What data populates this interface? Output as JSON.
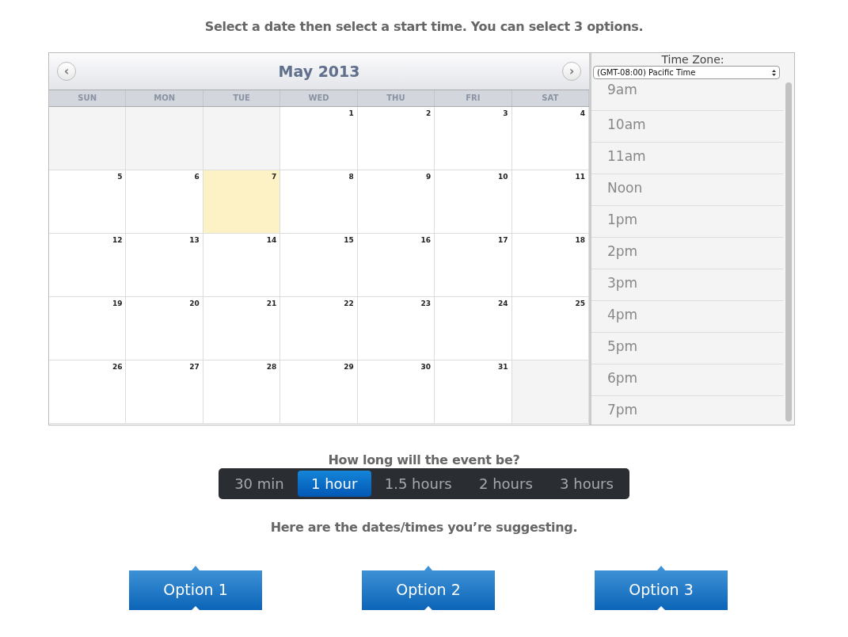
{
  "instructions": "Select a date then select a start time. You can select 3 options.",
  "calendar": {
    "title": "May 2013",
    "prev": "‹",
    "next": "›",
    "weekdays": [
      "SUN",
      "MON",
      "TUE",
      "WED",
      "THU",
      "FRI",
      "SAT"
    ],
    "weeks": [
      [
        {
          "kind": "blank"
        },
        {
          "kind": "blank"
        },
        {
          "kind": "blank"
        },
        {
          "kind": "day",
          "label": "1",
          "today": false
        },
        {
          "kind": "day",
          "label": "2",
          "today": false
        },
        {
          "kind": "day",
          "label": "3",
          "today": false
        },
        {
          "kind": "day",
          "label": "4",
          "today": false
        }
      ],
      [
        {
          "kind": "day",
          "label": "5",
          "today": false
        },
        {
          "kind": "day",
          "label": "6",
          "today": false
        },
        {
          "kind": "day",
          "label": "7",
          "today": true
        },
        {
          "kind": "day",
          "label": "8",
          "today": false
        },
        {
          "kind": "day",
          "label": "9",
          "today": false
        },
        {
          "kind": "day",
          "label": "10",
          "today": false
        },
        {
          "kind": "day",
          "label": "11",
          "today": false
        }
      ],
      [
        {
          "kind": "day",
          "label": "12",
          "today": false
        },
        {
          "kind": "day",
          "label": "13",
          "today": false
        },
        {
          "kind": "day",
          "label": "14",
          "today": false
        },
        {
          "kind": "day",
          "label": "15",
          "today": false
        },
        {
          "kind": "day",
          "label": "16",
          "today": false
        },
        {
          "kind": "day",
          "label": "17",
          "today": false
        },
        {
          "kind": "day",
          "label": "18",
          "today": false
        }
      ],
      [
        {
          "kind": "day",
          "label": "19",
          "today": false
        },
        {
          "kind": "day",
          "label": "20",
          "today": false
        },
        {
          "kind": "day",
          "label": "21",
          "today": false
        },
        {
          "kind": "day",
          "label": "22",
          "today": false
        },
        {
          "kind": "day",
          "label": "23",
          "today": false
        },
        {
          "kind": "day",
          "label": "24",
          "today": false
        },
        {
          "kind": "day",
          "label": "25",
          "today": false
        }
      ],
      [
        {
          "kind": "day",
          "label": "26",
          "today": false
        },
        {
          "kind": "day",
          "label": "27",
          "today": false
        },
        {
          "kind": "day",
          "label": "28",
          "today": false
        },
        {
          "kind": "day",
          "label": "29",
          "today": false
        },
        {
          "kind": "day",
          "label": "30",
          "today": false
        },
        {
          "kind": "day",
          "label": "31",
          "today": false
        },
        {
          "kind": "blank"
        }
      ]
    ]
  },
  "timezone": {
    "label": "Time Zone:",
    "value": "(GMT-08:00) Pacific Time"
  },
  "times": [
    "9am",
    "10am",
    "11am",
    "Noon",
    "1pm",
    "2pm",
    "3pm",
    "4pm",
    "5pm",
    "6pm",
    "7pm"
  ],
  "duration": {
    "question": "How long will the event be?",
    "options": [
      {
        "label": "30 min",
        "selected": false
      },
      {
        "label": "1 hour",
        "selected": true
      },
      {
        "label": "1.5 hours",
        "selected": false
      },
      {
        "label": "2 hours",
        "selected": false
      },
      {
        "label": "3 hours",
        "selected": false
      }
    ]
  },
  "suggest_heading": "Here are the dates/times you’re suggesting.",
  "options": [
    "Option 1",
    "Option 2",
    "Option 3"
  ]
}
